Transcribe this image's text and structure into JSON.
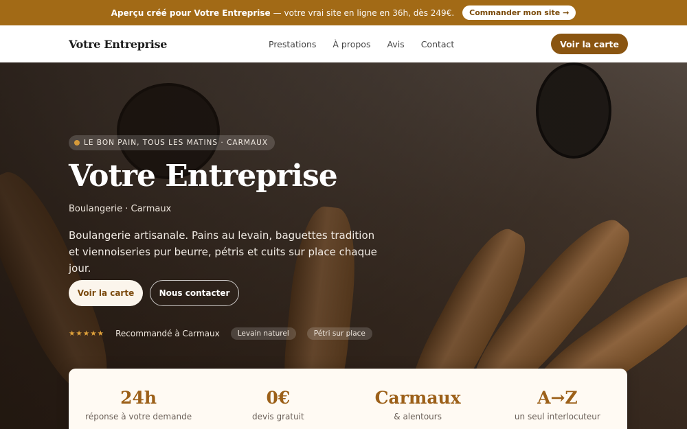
{
  "promo": {
    "headline": "Aperçu créé pour Votre Entreprise",
    "text": "— votre vrai site en ligne en 36h, dès 249€.",
    "cta": "Commander mon site →"
  },
  "nav": {
    "brand": "Votre Entreprise",
    "links": [
      "Prestations",
      "À propos",
      "Avis",
      "Contact"
    ],
    "cta": "Voir la carte"
  },
  "hero": {
    "eyebrow": "LE BON PAIN, TOUS LES MATINS · CARMAUX",
    "title": "Votre Entreprise",
    "subtitle": "Boulangerie · Carmaux",
    "description": "Boulangerie artisanale. Pains au levain, baguettes tradition et viennoiseries pur beurre, pétris et cuits sur place chaque jour.",
    "primary_cta": "Voir la carte",
    "secondary_cta": "Nous contacter",
    "rating_stars": "★★★★★",
    "recommended": "Recommandé à Carmaux",
    "chips": [
      "Levain naturel",
      "Pétri sur place"
    ]
  },
  "stats": [
    {
      "value": "24h",
      "label": "réponse à votre demande"
    },
    {
      "value": "0€",
      "label": "devis gratuit"
    },
    {
      "value": "Carmaux",
      "label": "& alentours"
    },
    {
      "value": "A→Z",
      "label": "un seul interlocuteur"
    }
  ],
  "colors": {
    "brand": "#8a5511",
    "promo_bg": "#a26a16",
    "accent": "#9c6019"
  }
}
